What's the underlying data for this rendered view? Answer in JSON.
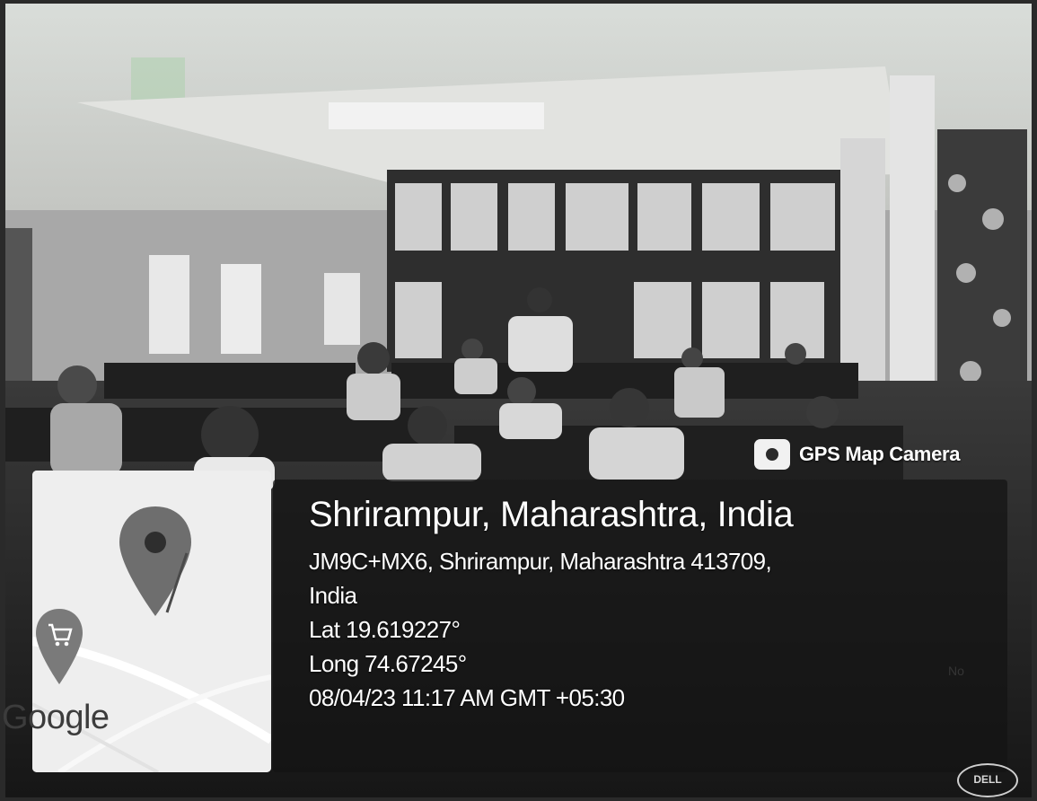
{
  "stamp": {
    "app_name": "GPS Map Camera",
    "app_icon": "camera-icon",
    "place": "Shrirampur, Maharashtra, India",
    "address_line1": "JM9C+MX6, Shrirampur, Maharashtra 413709,",
    "address_line2": "India",
    "latitude": "Lat 19.619227°",
    "longitude": "Long 74.67245°",
    "datetime": "08/04/23 11:17 AM GMT +05:30"
  },
  "map": {
    "provider": "Google",
    "pin_icon": "map-pin-icon",
    "shop_icon": "shopping-cart-pin-icon"
  },
  "photo": {
    "subject": "computer-lab-classroom",
    "bezel_logo": "DELL"
  }
}
